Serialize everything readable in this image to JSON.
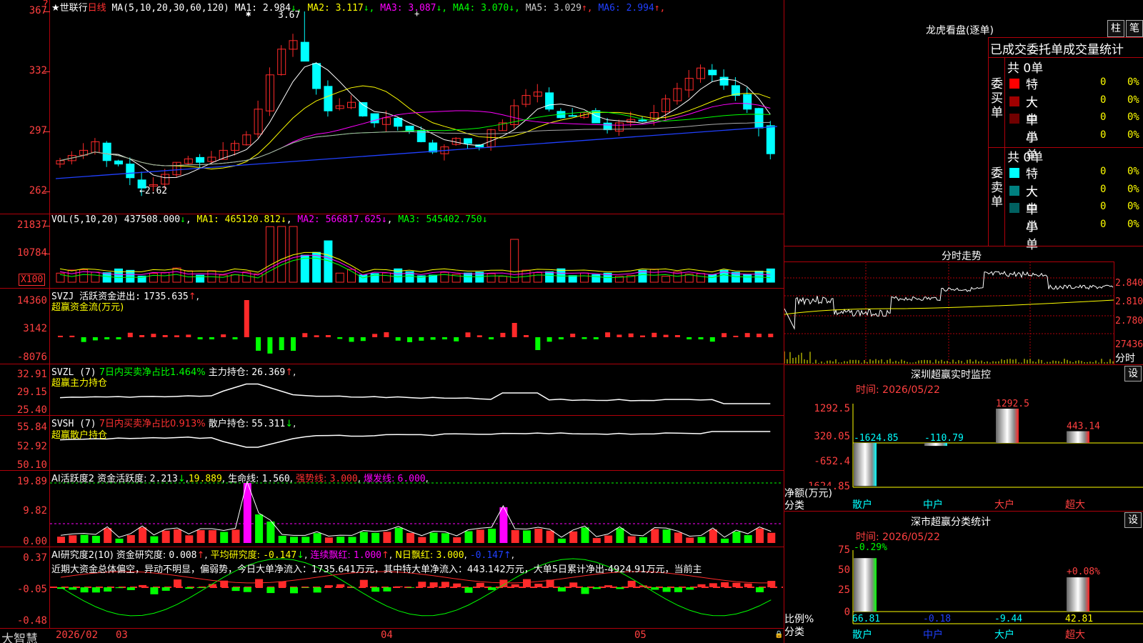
{
  "colors": {
    "up": "#ff2a2a",
    "down": "#00ffff",
    "grid": "#b0000a",
    "ma1": "#ffffff",
    "ma2": "#ffff00",
    "ma3": "#ff00ff",
    "ma4": "#00ff00",
    "ma5": "#aaaaaa",
    "ma6": "#0000ff"
  },
  "main": {
    "stock_name": "★世联行",
    "period": "日线",
    "ma_params": "MA(5,10,20,30,60,120)",
    "ma_values": [
      {
        "label": "MA1:",
        "value": "2.984",
        "arrow": "↓",
        "color": "#ffffff"
      },
      {
        "label": "MA2:",
        "value": "3.117",
        "arrow": "↓",
        "color": "#ffff00"
      },
      {
        "label": "MA3:",
        "value": "3.087",
        "arrow": "↓",
        "color": "#ff00ff"
      },
      {
        "label": "MA4:",
        "value": "3.070",
        "arrow": "↓",
        "color": "#00ff00"
      },
      {
        "label": "MA5:",
        "value": "3.029",
        "arrow": "↑",
        "color": "#cccccc"
      },
      {
        "label": "MA6:",
        "value": "2.994",
        "arrow": "↑",
        "color": "#2040ff"
      }
    ],
    "y_ticks": [
      "367",
      "332",
      "297",
      "262"
    ],
    "high_label": "3.67",
    "low_label": "←2.62"
  },
  "vol": {
    "title": "VOL(5,10,20)",
    "value": "437508.000",
    "ma1": "465120.812",
    "ma2": "566817.625",
    "ma3": "545402.750",
    "y_ticks": [
      "21837",
      "10784"
    ],
    "unit": "X100"
  },
  "svzj": {
    "title": "SVZJ  活跃资金进出:",
    "value": "1735.635",
    "subtitle": "超赢资金流(万元)",
    "y_ticks": [
      "14360",
      "3142",
      "-8076"
    ]
  },
  "svzl": {
    "title": "SVZL  (7)",
    "t1": "7日内买卖净占比1.464%",
    "t2": "主力持仓:",
    "value": "26.369",
    "subtitle": "超赢主力持仓",
    "y_ticks": [
      "32.91",
      "29.15",
      "25.40"
    ]
  },
  "svsh": {
    "title": "SVSH  (7)",
    "t1": "7日内买卖净占比0.913%",
    "t2": "散户持仓:",
    "value": "55.311",
    "subtitle": "超赢散户持仓",
    "y_ticks": [
      "55.84",
      "52.92",
      "50.10"
    ]
  },
  "ai1": {
    "title": "AI活跃度2",
    "t1": "资金活跃度:",
    "v1": "2.213",
    "v2": "19.889",
    "t3": "生命线:",
    "v3": "1.560",
    "t4": "强势线:",
    "v4": "3.000",
    "t5": "爆发线:",
    "v5": "6.000",
    "y_ticks": [
      "19.89",
      "9.82",
      "0.00"
    ]
  },
  "ai2": {
    "title": "AI研究度2(10)",
    "t1": "资金研究度:",
    "v1": "0.008",
    "t2": "平均研究度:",
    "v2": "-0.147",
    "t3": "连续飘红:",
    "v3": "1.000",
    "t4": "N日飘红:",
    "v4": "3.000",
    "v5": "-0.147",
    "note": "近期大资金总体偏空，异动不明显，偏弱势，今日大单净流入：1735.641万元，其中特大单净流入：443.142万元，大单5日累计净出-4924.91万元，当前主",
    "y_ticks": [
      "0.37",
      "-0.05",
      "-0.48"
    ]
  },
  "footer": {
    "brand": "大智慧",
    "dates": [
      "2026/02",
      "03",
      "04",
      "05"
    ]
  },
  "right": {
    "lhb_title": "龙虎看盘(逐单)",
    "btn_zhu": "柱",
    "btn_bi": "笔",
    "order_title": "已成交委托单成交量统计",
    "buy_label": "委买单",
    "sell_label": "委卖单",
    "buy_total": "共 0单",
    "sell_total": "共 0单",
    "buy_rows": [
      {
        "name": "特大",
        "count": "0",
        "pct": "0%",
        "color": "#ff0000"
      },
      {
        "name": "大单",
        "count": "0",
        "pct": "0%",
        "color": "#a00000"
      },
      {
        "name": "中单",
        "count": "0",
        "pct": "0%",
        "color": "#700000"
      },
      {
        "name": "小单",
        "count": "0",
        "pct": "0%",
        "color": ""
      }
    ],
    "sell_rows": [
      {
        "name": "特大",
        "count": "0",
        "pct": "0%",
        "color": "#00ffff"
      },
      {
        "name": "大单",
        "count": "0",
        "pct": "0%",
        "color": "#008080"
      },
      {
        "name": "中单",
        "count": "0",
        "pct": "0%",
        "color": "#006060"
      },
      {
        "name": "小单",
        "count": "0",
        "pct": "0%",
        "color": ""
      }
    ],
    "intraday_title": "分时走势",
    "intraday_ticks": [
      "2.840",
      "2.810",
      "2.780",
      "27436"
    ],
    "intraday_unit": "分时",
    "monitor_title": "深圳超赢实时监控",
    "monitor_btn": "设",
    "monitor_time": "时间: 2026/05/22",
    "monitor_ticks": [
      "1292.5",
      "320.05",
      "-652.4",
      "-1624.85"
    ],
    "monitor_ylabel": "净额(万元)",
    "monitor_xlabel": "分类",
    "stat_title": "深市超赢分类统计",
    "stat_btn": "设",
    "stat_time": "时间: 2026/05/22",
    "stat_ticks": [
      "75",
      "50",
      "25",
      "0"
    ],
    "stat_ylabel": "比例%",
    "stat_xlabel": "分类",
    "categories": [
      "散户",
      "中户",
      "大户",
      "超大"
    ]
  },
  "chart_data": [
    {
      "type": "bar",
      "title": "深圳超赢实时监控",
      "categories": [
        "散户",
        "中户",
        "大户",
        "超大"
      ],
      "values": [
        -1624.85,
        -110.79,
        1292.5,
        443.14
      ],
      "ylabel": "净额(万元)",
      "ylim": [
        -1624.85,
        1292.5
      ]
    },
    {
      "type": "bar",
      "title": "深市超赢分类统计",
      "categories": [
        "散户",
        "中户",
        "大户",
        "超大"
      ],
      "series": [
        {
          "values": [
            66.81,
            -0.18,
            -9.44,
            42.81
          ]
        },
        {
          "values": [
            -0.29,
            null,
            null,
            0.08
          ]
        }
      ],
      "ylabel": "比例%",
      "ylim": [
        0,
        75
      ]
    }
  ]
}
